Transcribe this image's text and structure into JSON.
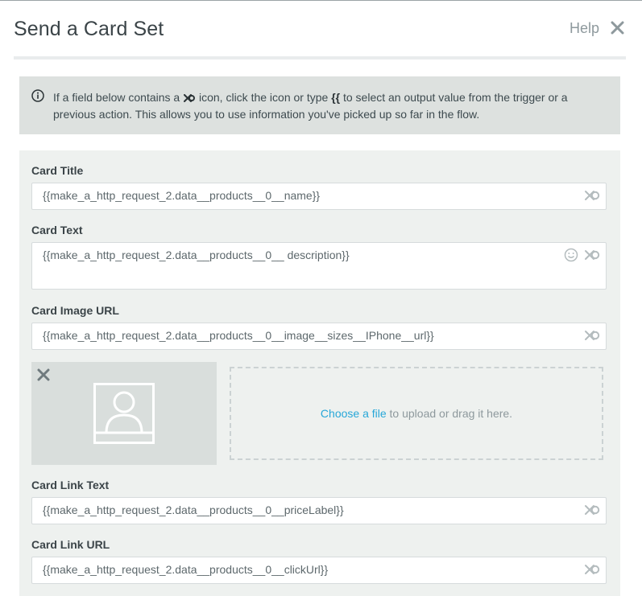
{
  "dialog": {
    "title": "Send a Card Set",
    "help_label": "Help"
  },
  "info": {
    "text_before_icon": "If a field below contains a",
    "text_after_icon": "icon, click the icon or type",
    "brace_token": "{{",
    "text_end": "to select an output value from the trigger or a previous action. This allows you to use information you've picked up so far in the flow."
  },
  "fields": {
    "card_title": {
      "label": "Card Title",
      "value": "{{make_a_http_request_2.data__products__0__name}}"
    },
    "card_text": {
      "label": "Card Text",
      "value": "{{make_a_http_request_2.data__products__0__ description}}"
    },
    "card_image_url": {
      "label": "Card Image URL",
      "value": "{{make_a_http_request_2.data__products__0__image__sizes__IPhone__url}}"
    },
    "card_link_text": {
      "label": "Card Link Text",
      "value": "{{make_a_http_request_2.data__products__0__priceLabel}}"
    },
    "card_link_url": {
      "label": "Card Link URL",
      "value": "{{make_a_http_request_2.data__products__0__clickUrl}}"
    }
  },
  "upload": {
    "choose_link": "Choose a file",
    "rest_text": "to upload or drag it here."
  },
  "icons": {
    "close": "close-icon",
    "info": "info-icon",
    "output_link": "link-output-icon",
    "emoji": "emoji-icon",
    "image_placeholder": "image-placeholder-icon",
    "remove": "remove-image-icon"
  },
  "colors": {
    "accent_link": "#27a7d8",
    "panel_bg": "#eef1ef",
    "info_bg": "#dde1df"
  }
}
